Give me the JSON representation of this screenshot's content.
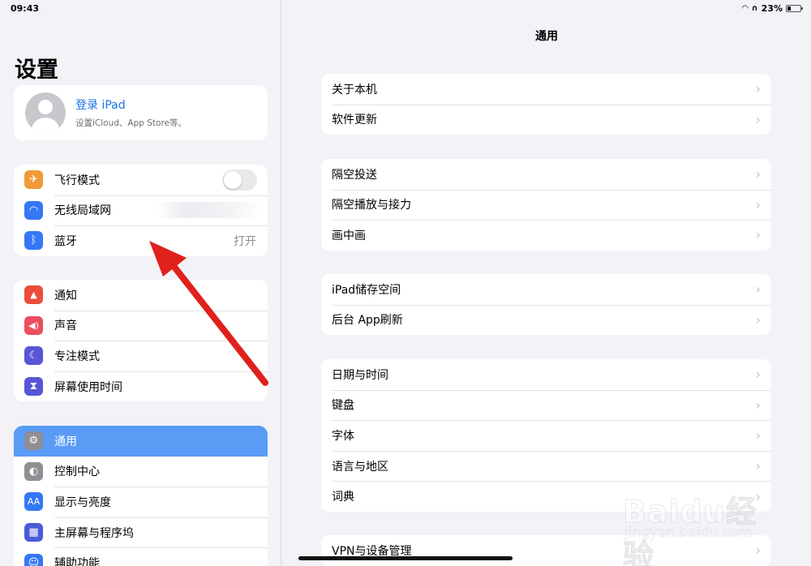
{
  "status": {
    "time": "09:43",
    "battery": "23%"
  },
  "sidebar": {
    "title": "设置",
    "profile": {
      "name": "登录 iPad",
      "subtitle": "设置iCloud、App Store等。"
    },
    "group1": [
      {
        "label": "飞行模式",
        "icon": "airplane-icon",
        "color": "#f09a37",
        "glyph": "✈"
      },
      {
        "label": "无线局域网",
        "icon": "wifi-icon",
        "color": "#3478f6",
        "glyph": "◠"
      },
      {
        "label": "蓝牙",
        "icon": "bluetooth-icon",
        "color": "#3478f6",
        "glyph": "ᛒ",
        "value": "打开"
      }
    ],
    "group2": [
      {
        "label": "通知",
        "icon": "bell-icon",
        "color": "#eb4e3d",
        "glyph": "🔔"
      },
      {
        "label": "声音",
        "icon": "speaker-icon",
        "color": "#eb4e5e",
        "glyph": "🔊"
      },
      {
        "label": "专注模式",
        "icon": "moon-icon",
        "color": "#5856d6",
        "glyph": "☾"
      },
      {
        "label": "屏幕使用时间",
        "icon": "hourglass-icon",
        "color": "#5856d6",
        "glyph": "⌛"
      }
    ],
    "group3": [
      {
        "label": "通用",
        "icon": "gear-icon",
        "color": "#8e8e93",
        "glyph": "⚙"
      },
      {
        "label": "控制中心",
        "icon": "switches-icon",
        "color": "#8e8e93",
        "glyph": "◐"
      },
      {
        "label": "显示与亮度",
        "icon": "text-size-icon",
        "color": "#3478f6",
        "glyph": "AA"
      },
      {
        "label": "主屏幕与程序坞",
        "icon": "home-grid-icon",
        "color": "#4a5bd8",
        "glyph": "▦"
      },
      {
        "label": "辅助功能",
        "icon": "accessibility-icon",
        "color": "#3478f6",
        "glyph": "♿"
      }
    ]
  },
  "main": {
    "title": "通用",
    "groups": [
      [
        "关于本机",
        "软件更新"
      ],
      [
        "隔空投送",
        "隔空播放与接力",
        "画中画"
      ],
      [
        "iPad储存空间",
        "后台 App刷新"
      ],
      [
        "日期与时间",
        "键盘",
        "字体",
        "语言与地区",
        "词典"
      ],
      [
        "VPN与设备管理"
      ]
    ]
  },
  "watermark": {
    "brand": "Baidu经验",
    "url": "jingyan.baidu.com"
  },
  "annotation_color": "#e0201c"
}
